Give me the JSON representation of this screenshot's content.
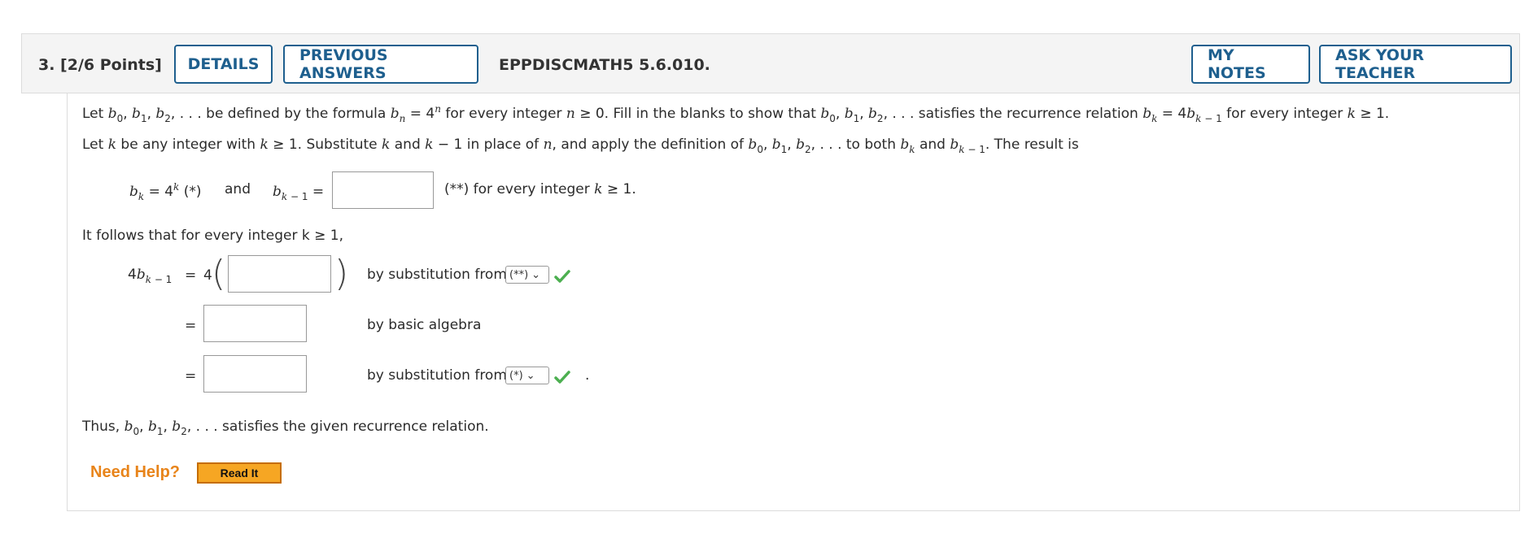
{
  "header": {
    "question_number": "3. [2/6 Points]",
    "details_label": "DETAILS",
    "previous_answers_label": "PREVIOUS ANSWERS",
    "problem_code": "EPPDISCMATH5 5.6.010.",
    "my_notes_label": "MY NOTES",
    "ask_teacher_label": "ASK YOUR TEACHER"
  },
  "problem": {
    "line1": {
      "t1": "Let ",
      "t2": " be defined by the formula ",
      "t3": " for every integer ",
      "t4": " ≥ 0. Fill in the blanks to show that ",
      "t5": " satisfies the recurrence relation ",
      "t6": " for every integer ",
      "t7": " ≥ 1."
    },
    "line2": {
      "t1": "Let ",
      "t2": " be any integer with ",
      "t3": " ≥ 1. Substitute ",
      "t4": " and ",
      "t5": " − 1 in place of ",
      "t6": ", and apply the definition of ",
      "t7": " to both ",
      "t8": " and ",
      "t9": ". The result is"
    },
    "result_line": {
      "bk_eq": " = 4",
      "star": " (*)",
      "and": "and",
      "eq": " =",
      "double_star": "(**) for every integer ",
      "end": " ≥ 1."
    },
    "follows": "It follows that for every integer k ≥ 1,",
    "steps": [
      {
        "lhs_prefix": "4",
        "eq": "=",
        "coef": "4",
        "reason": "by substitution from",
        "select_value": "(**)"
      },
      {
        "eq": "=",
        "reason": "by basic algebra"
      },
      {
        "eq": "=",
        "reason": "by substitution from",
        "select_value": "(*)",
        "trailing": "."
      }
    ],
    "conclusion": {
      "t1": "Thus, ",
      "t2": " satisfies the given recurrence relation."
    }
  },
  "help": {
    "need_help": "Need Help?",
    "read_it": "Read It"
  },
  "colors": {
    "button_border": "#1e5f8e",
    "need_help": "#e8841a",
    "check": "#4caf50"
  }
}
